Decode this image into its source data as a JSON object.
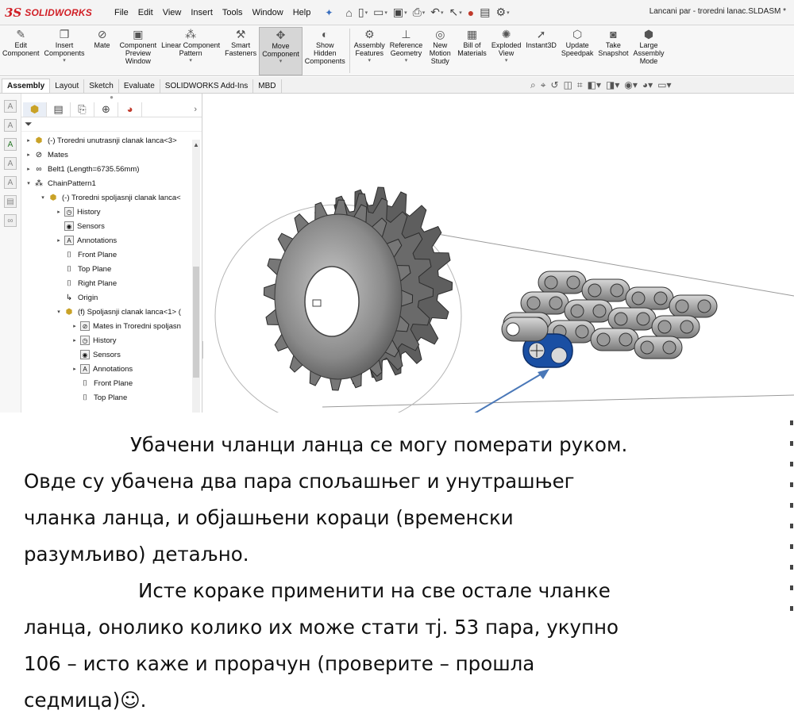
{
  "app": {
    "logo_mark": "3S",
    "logo_text": "SOLIDWORKS"
  },
  "menu": [
    "File",
    "Edit",
    "View",
    "Insert",
    "Tools",
    "Window",
    "Help"
  ],
  "document_title": "Lancani par - troredni lanac.SLDASM *",
  "commands": [
    {
      "label": "Edit\nComponent"
    },
    {
      "label": "Insert\nComponents"
    },
    {
      "label": "Mate"
    },
    {
      "label": "Component\nPreview\nWindow"
    },
    {
      "label": "Linear Component\nPattern"
    },
    {
      "label": "Smart\nFasteners"
    },
    {
      "label": "Move\nComponent"
    },
    {
      "label": "Show\nHidden\nComponents"
    },
    {
      "label": "Assembly\nFeatures"
    },
    {
      "label": "Reference\nGeometry"
    },
    {
      "label": "New\nMotion\nStudy"
    },
    {
      "label": "Bill of\nMaterials"
    },
    {
      "label": "Exploded\nView"
    },
    {
      "label": "Instant3D"
    },
    {
      "label": "Update\nSpeedpak"
    },
    {
      "label": "Take\nSnapshot"
    },
    {
      "label": "Large\nAssembly\nMode"
    }
  ],
  "tabs": [
    "Assembly",
    "Layout",
    "Sketch",
    "Evaluate",
    "SOLIDWORKS Add-Ins",
    "MBD"
  ],
  "tree": [
    "(-) Troredni unutrasnji clanak lanca<3>",
    "Mates",
    "Belt1 (Length=6735.56mm)",
    "ChainPattern1",
    "(-) Troredni spoljasnji clanak lanca<",
    "History",
    "Sensors",
    "Annotations",
    "Front Plane",
    "Top Plane",
    "Right Plane",
    "Origin",
    "(f) Spoljasnji clanak lanca<1> (",
    "Mates in Troredni spoljasn",
    "History",
    "Sensors",
    "Annotations",
    "Front Plane",
    "Top Plane"
  ],
  "caption": [
    "Убачени чланци ланца се могу померати руком.",
    "Овде су убачена два пара спољашњег и унутрашњег",
    "чланка ланца, и објашњени кораци (временски",
    "разумљиво) детаљно.",
    "Исте кораке применити на све остале чланке",
    "ланца, онолико колико их може стати тј. 53 пара, укупно",
    "106 – исто каже и прорачун (проверите – прошла",
    "седмица)☺."
  ],
  "colors": {
    "brand": "#d11f26",
    "highlight": "#1a4fa3",
    "arrow": "#4a78b8"
  }
}
